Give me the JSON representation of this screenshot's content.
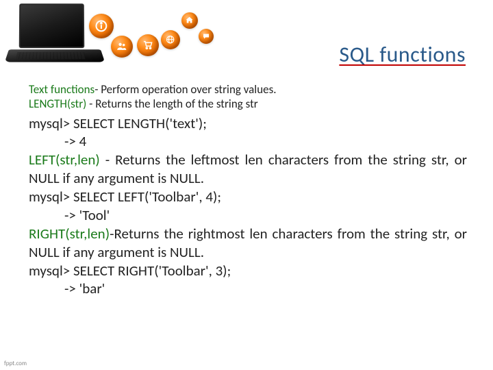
{
  "title": "SQL functions",
  "intro": {
    "text_functions_label": "Text functions",
    "text_functions_desc": "- Perform operation over string values.",
    "length_sig": "LENGTH(str)",
    "length_desc": " - Returns the length of the string str"
  },
  "body": {
    "length_cmd": "mysql> SELECT LENGTH('text');",
    "length_out": "-> 4",
    "left_sig": "LEFT(str,len)",
    "left_desc": " - Returns the leftmost len characters from the string str, or NULL if any argument is NULL.",
    "left_cmd": "mysql> SELECT LEFT('Toolbar', 4);",
    "left_out": "-> 'Tool'",
    "right_sig": "RIGHT(str,len)",
    "right_desc": "-Returns the rightmost len characters from the string str, or NULL if any argument is NULL.",
    "right_cmd": "mysql> SELECT RIGHT('Toolbar', 3);",
    "right_out": "-> 'bar'"
  },
  "footer": "fppt.com",
  "icons": {
    "o1": "info",
    "o2": "people",
    "o3": "cart",
    "o4": "globe",
    "o5": "home",
    "o6": "chat"
  }
}
